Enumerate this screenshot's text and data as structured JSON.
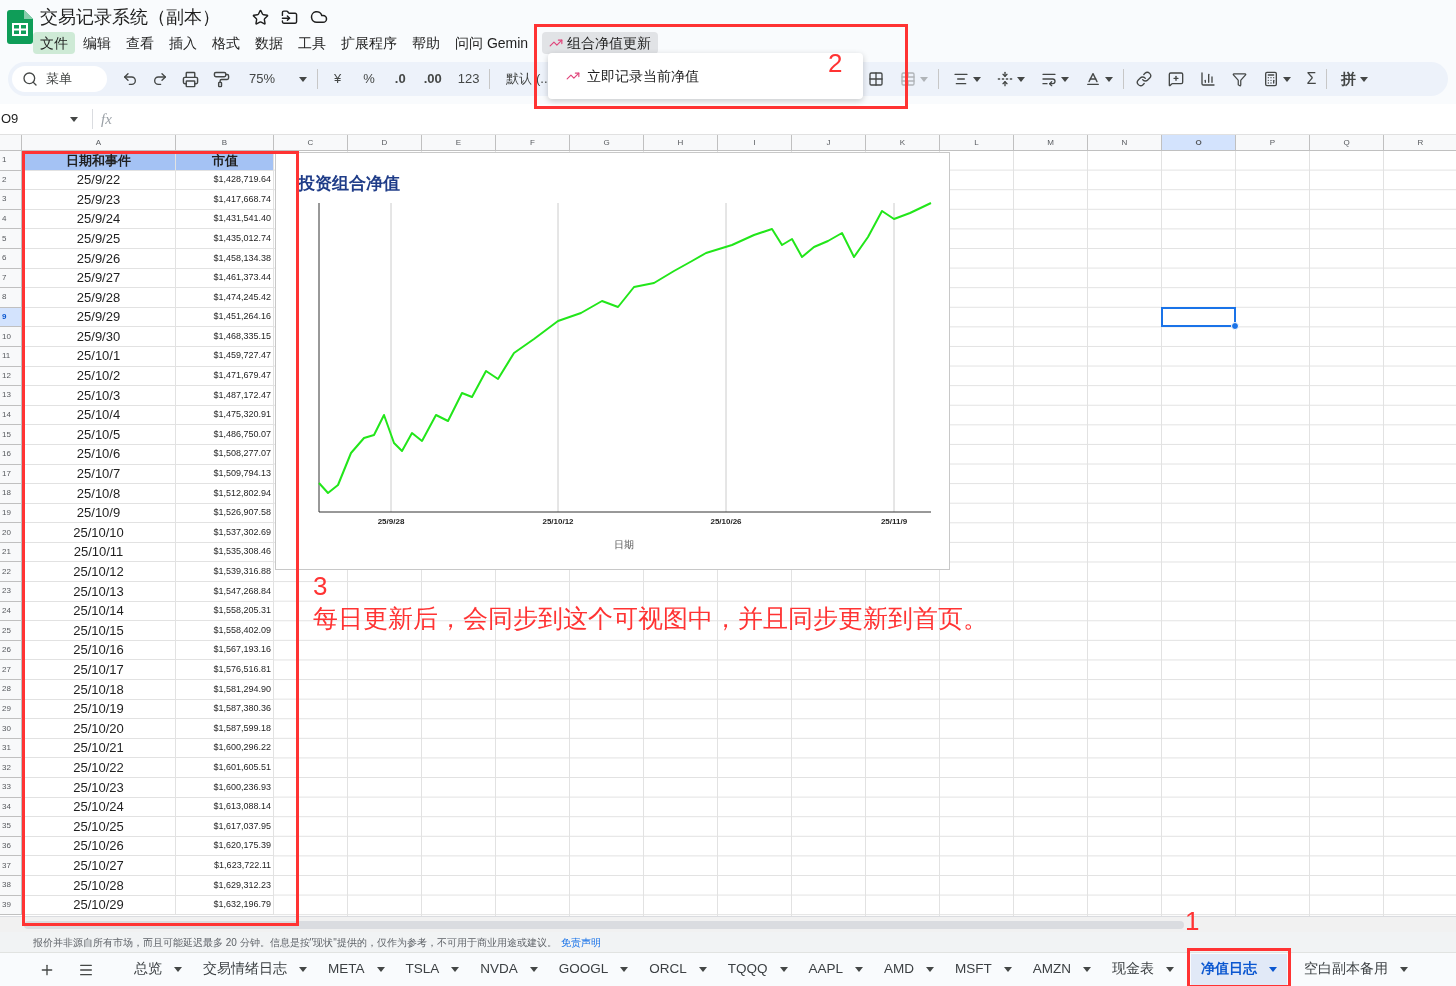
{
  "app": {
    "title": "交易记录系统（副本）"
  },
  "menu": [
    {
      "label": "文件",
      "selected": true,
      "open": false
    },
    {
      "label": "编辑",
      "selected": false,
      "open": false
    },
    {
      "label": "查看",
      "selected": false,
      "open": false
    },
    {
      "label": "插入",
      "selected": false,
      "open": false
    },
    {
      "label": "格式",
      "selected": false,
      "open": false
    },
    {
      "label": "数据",
      "selected": false,
      "open": false
    },
    {
      "label": "工具",
      "selected": false,
      "open": false
    },
    {
      "label": "扩展程序",
      "selected": false,
      "open": false
    },
    {
      "label": "帮助",
      "selected": false,
      "open": false
    },
    {
      "label": "问问 Gemin",
      "selected": false,
      "open": false
    },
    {
      "label": "组合净值更新",
      "selected": false,
      "open": true
    }
  ],
  "dropdown": {
    "items": [
      "立即记录当前净值"
    ]
  },
  "toolbar": {
    "search_placeholder": "菜单",
    "zoom": "75%",
    "currency": "¥",
    "percent": "%",
    "decrease_decimal": ".0",
    "increase_decimal": ".00",
    "number_format": "123",
    "font": "默认 (..",
    "sum": "Σ",
    "input_method": "拼"
  },
  "formula_bar": {
    "name_box": "O9",
    "fx": "fx"
  },
  "columns": [
    {
      "label": "A",
      "selected": false
    },
    {
      "label": "B",
      "selected": false
    },
    {
      "label": "C",
      "selected": false
    },
    {
      "label": "D",
      "selected": false
    },
    {
      "label": "E",
      "selected": false
    },
    {
      "label": "F",
      "selected": false
    },
    {
      "label": "G",
      "selected": false
    },
    {
      "label": "H",
      "selected": false
    },
    {
      "label": "I",
      "selected": false
    },
    {
      "label": "J",
      "selected": false
    },
    {
      "label": "K",
      "selected": false
    },
    {
      "label": "L",
      "selected": false
    },
    {
      "label": "M",
      "selected": false
    },
    {
      "label": "N",
      "selected": false
    },
    {
      "label": "O",
      "selected": true
    },
    {
      "label": "P",
      "selected": false
    },
    {
      "label": "Q",
      "selected": false
    },
    {
      "label": "R",
      "selected": false
    }
  ],
  "rows": [
    {
      "number": "1",
      "selected": false,
      "kind": "header",
      "date": "日期和事件",
      "value": "市值"
    },
    {
      "number": "2",
      "selected": false,
      "kind": "data",
      "date": "25/9/22",
      "value": "$1,428,719.64"
    },
    {
      "number": "3",
      "selected": false,
      "kind": "data",
      "date": "25/9/23",
      "value": "$1,417,668.74"
    },
    {
      "number": "4",
      "selected": false,
      "kind": "data",
      "date": "25/9/24",
      "value": "$1,431,541.40"
    },
    {
      "number": "5",
      "selected": false,
      "kind": "data",
      "date": "25/9/25",
      "value": "$1,435,012.74"
    },
    {
      "number": "6",
      "selected": false,
      "kind": "data",
      "date": "25/9/26",
      "value": "$1,458,134.38"
    },
    {
      "number": "7",
      "selected": false,
      "kind": "data",
      "date": "25/9/27",
      "value": "$1,461,373.44"
    },
    {
      "number": "8",
      "selected": false,
      "kind": "data",
      "date": "25/9/28",
      "value": "$1,474,245.42"
    },
    {
      "number": "9",
      "selected": true,
      "kind": "data",
      "date": "25/9/29",
      "value": "$1,451,264.16"
    },
    {
      "number": "10",
      "selected": false,
      "kind": "data",
      "date": "25/9/30",
      "value": "$1,468,335.15"
    },
    {
      "number": "11",
      "selected": false,
      "kind": "data",
      "date": "25/10/1",
      "value": "$1,459,727.47"
    },
    {
      "number": "12",
      "selected": false,
      "kind": "data",
      "date": "25/10/2",
      "value": "$1,471,679.47"
    },
    {
      "number": "13",
      "selected": false,
      "kind": "data",
      "date": "25/10/3",
      "value": "$1,487,172.47"
    },
    {
      "number": "14",
      "selected": false,
      "kind": "data",
      "date": "25/10/4",
      "value": "$1,475,320.91"
    },
    {
      "number": "15",
      "selected": false,
      "kind": "data",
      "date": "25/10/5",
      "value": "$1,486,750.07"
    },
    {
      "number": "16",
      "selected": false,
      "kind": "data",
      "date": "25/10/6",
      "value": "$1,508,277.07"
    },
    {
      "number": "17",
      "selected": false,
      "kind": "data",
      "date": "25/10/7",
      "value": "$1,509,794.13"
    },
    {
      "number": "18",
      "selected": false,
      "kind": "data",
      "date": "25/10/8",
      "value": "$1,512,802.94"
    },
    {
      "number": "19",
      "selected": false,
      "kind": "data",
      "date": "25/10/9",
      "value": "$1,526,907.58"
    },
    {
      "number": "20",
      "selected": false,
      "kind": "data",
      "date": "25/10/10",
      "value": "$1,537,302.69"
    },
    {
      "number": "21",
      "selected": false,
      "kind": "data",
      "date": "25/10/11",
      "value": "$1,535,308.46"
    },
    {
      "number": "22",
      "selected": false,
      "kind": "data",
      "date": "25/10/12",
      "value": "$1,539,316.88"
    },
    {
      "number": "23",
      "selected": false,
      "kind": "data",
      "date": "25/10/13",
      "value": "$1,547,268.84"
    },
    {
      "number": "24",
      "selected": false,
      "kind": "data",
      "date": "25/10/14",
      "value": "$1,558,205.31"
    },
    {
      "number": "25",
      "selected": false,
      "kind": "data",
      "date": "25/10/15",
      "value": "$1,558,402.09"
    },
    {
      "number": "26",
      "selected": false,
      "kind": "data",
      "date": "25/10/16",
      "value": "$1,567,193.16"
    },
    {
      "number": "27",
      "selected": false,
      "kind": "data",
      "date": "25/10/17",
      "value": "$1,576,516.81"
    },
    {
      "number": "28",
      "selected": false,
      "kind": "data",
      "date": "25/10/18",
      "value": "$1,581,294.90"
    },
    {
      "number": "29",
      "selected": false,
      "kind": "data",
      "date": "25/10/19",
      "value": "$1,587,380.36"
    },
    {
      "number": "30",
      "selected": false,
      "kind": "data",
      "date": "25/10/20",
      "value": "$1,587,599.18"
    },
    {
      "number": "31",
      "selected": false,
      "kind": "data",
      "date": "25/10/21",
      "value": "$1,600,296.22"
    },
    {
      "number": "32",
      "selected": false,
      "kind": "data",
      "date": "25/10/22",
      "value": "$1,601,605.51"
    },
    {
      "number": "33",
      "selected": false,
      "kind": "data",
      "date": "25/10/23",
      "value": "$1,600,236.93"
    },
    {
      "number": "34",
      "selected": false,
      "kind": "data",
      "date": "25/10/24",
      "value": "$1,613,088.14"
    },
    {
      "number": "35",
      "selected": false,
      "kind": "data",
      "date": "25/10/25",
      "value": "$1,617,037.95"
    },
    {
      "number": "36",
      "selected": false,
      "kind": "data",
      "date": "25/10/26",
      "value": "$1,620,175.39"
    },
    {
      "number": "37",
      "selected": false,
      "kind": "data",
      "date": "25/10/27",
      "value": "$1,623,722.11"
    },
    {
      "number": "38",
      "selected": false,
      "kind": "data",
      "date": "25/10/28",
      "value": "$1,629,312.23"
    },
    {
      "number": "39",
      "selected": false,
      "kind": "data",
      "date": "25/10/29",
      "value": "$1,632,196.79"
    }
  ],
  "chart": {
    "title": "投资组合净值",
    "xticks": [
      "25/9/28",
      "25/10/12",
      "25/10/26",
      "25/11/9"
    ],
    "xlabel": "日期"
  },
  "annotations": {
    "numbers": [
      "1",
      "2",
      "3"
    ],
    "note": "每日更新后，会同步到这个可视图中，并且同步更新到首页。"
  },
  "disclaimer": {
    "text": "报价并非源自所有市场，而且可能延迟最多 20 分钟。信息是按\"现状\"提供的，仅作为参考，不可用于商业用途或建议。",
    "link": "免责声明"
  },
  "sheets": [
    {
      "label": "总览",
      "selected": false
    },
    {
      "label": "交易情绪日志",
      "selected": false
    },
    {
      "label": "META",
      "selected": false
    },
    {
      "label": "TSLA",
      "selected": false
    },
    {
      "label": "NVDA",
      "selected": false
    },
    {
      "label": "GOOGL",
      "selected": false
    },
    {
      "label": "ORCL",
      "selected": false
    },
    {
      "label": "TQQQ",
      "selected": false
    },
    {
      "label": "AAPL",
      "selected": false
    },
    {
      "label": "AMD",
      "selected": false
    },
    {
      "label": "MSFT",
      "selected": false
    },
    {
      "label": "AMZN",
      "selected": false
    },
    {
      "label": "现金表",
      "selected": false
    },
    {
      "label": "净值日志",
      "selected": true
    },
    {
      "label": "空白副本备用",
      "selected": false
    }
  ]
}
